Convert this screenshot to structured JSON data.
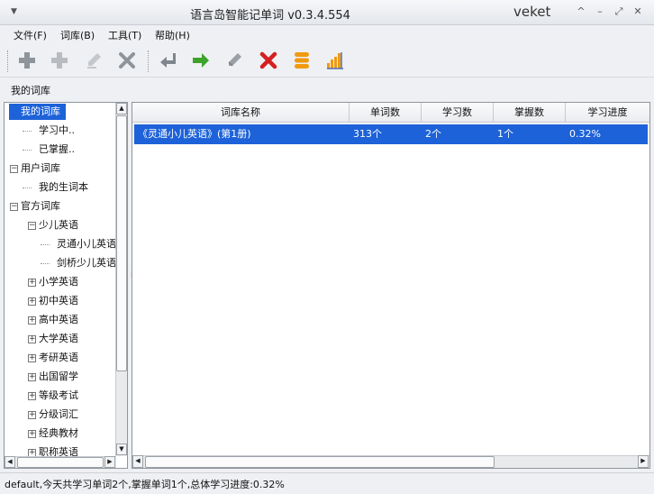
{
  "window": {
    "title": "语言岛智能记单词 v0.3.4.554",
    "app_name": "veket",
    "controls": [
      "^",
      "–",
      "⤢",
      "✕"
    ]
  },
  "menu": [
    "文件(F)",
    "词库(B)",
    "工具(T)",
    "帮助(H)"
  ],
  "toolbar": {
    "icons": [
      "add-icon",
      "add-disabled-icon",
      "edit-disabled-icon",
      "delete-disabled-icon",
      "back-arrow-icon",
      "forward-arrow-icon",
      "edit-icon",
      "delete-icon",
      "database-icon",
      "bar-chart-icon"
    ]
  },
  "section_label": "我的词库",
  "tree": [
    {
      "label": "我的词库",
      "level": 0,
      "expander": "−",
      "selected": true
    },
    {
      "label": "学习中..",
      "level": 1
    },
    {
      "label": "已掌握..",
      "level": 1
    },
    {
      "label": "用户词库",
      "level": 0,
      "expander": "−"
    },
    {
      "label": "我的生词本",
      "level": 1
    },
    {
      "label": "官方词库",
      "level": 0,
      "expander": "−"
    },
    {
      "label": "少儿英语",
      "level": 1,
      "expander": "−"
    },
    {
      "label": "灵通小儿英语",
      "level": 2
    },
    {
      "label": "剑桥少儿英语",
      "level": 2
    },
    {
      "label": "小学英语",
      "level": 1,
      "expander": "+"
    },
    {
      "label": "初中英语",
      "level": 1,
      "expander": "+"
    },
    {
      "label": "高中英语",
      "level": 1,
      "expander": "+"
    },
    {
      "label": "大学英语",
      "level": 1,
      "expander": "+"
    },
    {
      "label": "考研英语",
      "level": 1,
      "expander": "+"
    },
    {
      "label": "出国留学",
      "level": 1,
      "expander": "+"
    },
    {
      "label": "等级考试",
      "level": 1,
      "expander": "+"
    },
    {
      "label": "分级词汇",
      "level": 1,
      "expander": "+"
    },
    {
      "label": "经典教材",
      "level": 1,
      "expander": "+"
    },
    {
      "label": "职称英语",
      "level": 1,
      "expander": "+"
    }
  ],
  "table": {
    "columns": [
      "词库名称",
      "单词数",
      "学习数",
      "掌握数",
      "学习进度"
    ],
    "rows": [
      [
        "《灵通小儿英语》(第1册)",
        "313个",
        "2个",
        "1个",
        "0.32%"
      ]
    ]
  },
  "status": "default,今天共学习单词2个,掌握单词1个,总体学习进度:0.32%",
  "colors": {
    "selection": "#1d62d8",
    "red": "#d42020",
    "green": "#3ea32a",
    "orange": "#f09a10"
  }
}
